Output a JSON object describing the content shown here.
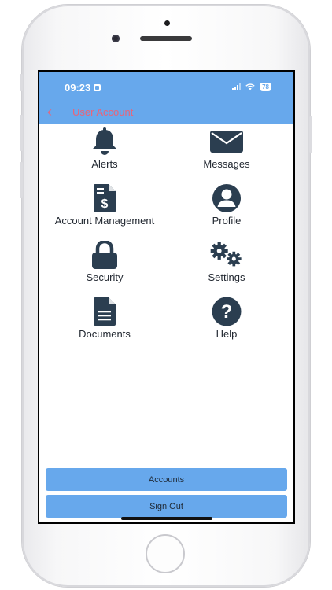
{
  "status_bar": {
    "time": "09:23",
    "battery": "78"
  },
  "nav": {
    "back_glyph": "‹",
    "title": "User Account"
  },
  "menu": [
    {
      "label": "Alerts",
      "icon": "bell-icon"
    },
    {
      "label": "Messages",
      "icon": "envelope-icon"
    },
    {
      "label": "Account Management",
      "icon": "invoice-dollar-icon"
    },
    {
      "label": "Profile",
      "icon": "user-circle-icon"
    },
    {
      "label": "Security",
      "icon": "lock-icon"
    },
    {
      "label": "Settings",
      "icon": "gears-icon"
    },
    {
      "label": "Documents",
      "icon": "document-icon"
    },
    {
      "label": "Help",
      "icon": "question-circle-icon"
    }
  ],
  "buttons": {
    "accounts": "Accounts",
    "sign_out": "Sign Out"
  },
  "colors": {
    "header": "#67a8ec",
    "icon": "#2b3e50",
    "nav_text": "#e8647a"
  }
}
